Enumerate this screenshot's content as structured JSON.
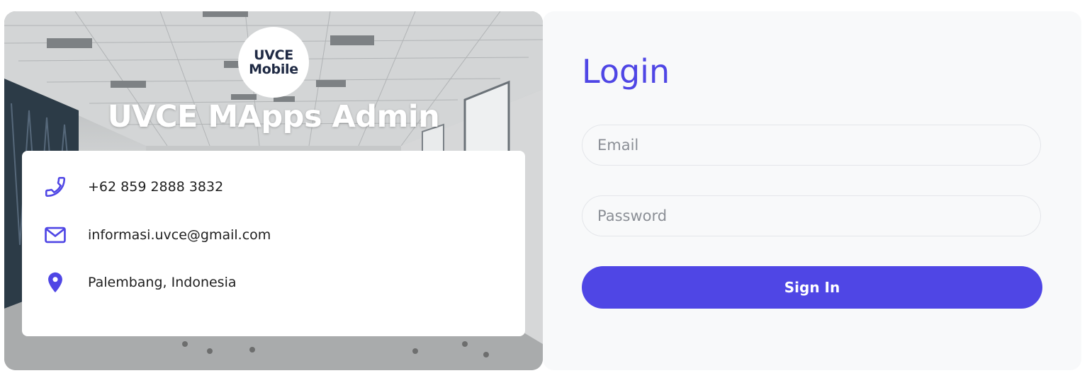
{
  "brand": {
    "logo_line1": "UVCE",
    "logo_line2": "Mobile",
    "title": "UVCE MApps Admin"
  },
  "contact": {
    "items": [
      {
        "icon": "phone-icon",
        "text": "+62 859 2888 3832"
      },
      {
        "icon": "mail-icon",
        "text": "informasi.uvce@gmail.com"
      },
      {
        "icon": "location-pin-icon",
        "text": "Palembang, Indonesia"
      }
    ]
  },
  "login": {
    "title": "Login",
    "email_placeholder": "Email",
    "password_placeholder": "Password",
    "signin_label": "Sign In"
  },
  "colors": {
    "accent": "#4f46e5",
    "panel_bg": "#f8f9fa",
    "logo_text": "#1f2a44"
  }
}
